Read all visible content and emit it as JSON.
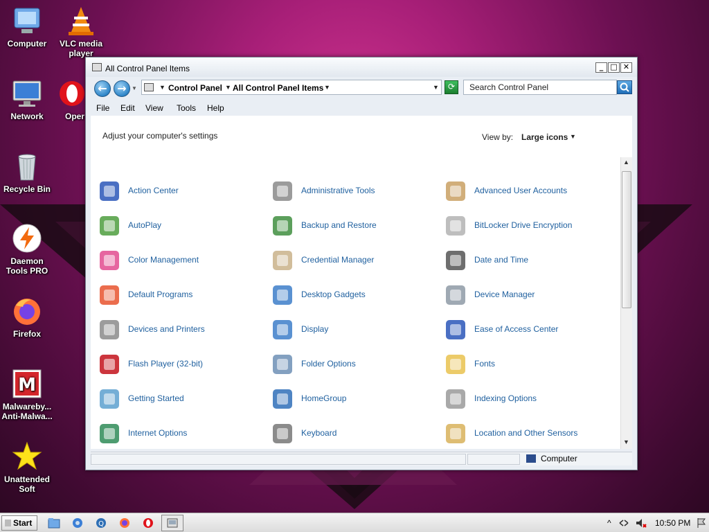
{
  "desktop": {
    "icons": [
      {
        "name": "computer",
        "label": "Computer"
      },
      {
        "name": "vlc",
        "label": "VLC media player"
      },
      {
        "name": "network",
        "label": "Network"
      },
      {
        "name": "opera",
        "label": "Opera Browser"
      },
      {
        "name": "recycle",
        "label": "Recycle Bin"
      },
      {
        "name": "daemon",
        "label": "Daemon Tools PRO"
      },
      {
        "name": "firefox",
        "label": "Firefox"
      },
      {
        "name": "malwarebytes",
        "label": "Malwareby... Anti-Malwa..."
      },
      {
        "name": "unattended",
        "label": "Unattended Soft"
      }
    ]
  },
  "window": {
    "title": "All Control Panel Items",
    "controls": {
      "minimize": "_",
      "maximize": "□",
      "close": "✕"
    },
    "address": {
      "crumbs": [
        "Control Panel",
        "All Control Panel Items"
      ]
    },
    "search": {
      "placeholder": "Search Control Panel"
    },
    "menu": [
      "File",
      "Edit",
      "View",
      "Tools",
      "Help"
    ],
    "heading": "Adjust your computer's settings",
    "view_by_label": "View by:",
    "view_by_value": "Large icons",
    "items": [
      {
        "label": "Action Center",
        "icon": "flag-icon"
      },
      {
        "label": "Administrative Tools",
        "icon": "tools-icon"
      },
      {
        "label": "Advanced User Accounts",
        "icon": "users-icon"
      },
      {
        "label": "AutoPlay",
        "icon": "autoplay-icon"
      },
      {
        "label": "Backup and Restore",
        "icon": "backup-icon"
      },
      {
        "label": "BitLocker Drive Encryption",
        "icon": "bitlocker-icon"
      },
      {
        "label": "Color Management",
        "icon": "color-icon"
      },
      {
        "label": "Credential Manager",
        "icon": "credential-icon"
      },
      {
        "label": "Date and Time",
        "icon": "clock-icon"
      },
      {
        "label": "Default Programs",
        "icon": "default-programs-icon"
      },
      {
        "label": "Desktop Gadgets",
        "icon": "gadgets-icon"
      },
      {
        "label": "Device Manager",
        "icon": "device-manager-icon"
      },
      {
        "label": "Devices and Printers",
        "icon": "printer-icon"
      },
      {
        "label": "Display",
        "icon": "display-icon"
      },
      {
        "label": "Ease of Access Center",
        "icon": "ease-access-icon"
      },
      {
        "label": "Flash Player (32-bit)",
        "icon": "flash-icon"
      },
      {
        "label": "Folder Options",
        "icon": "folder-icon"
      },
      {
        "label": "Fonts",
        "icon": "fonts-icon"
      },
      {
        "label": "Getting Started",
        "icon": "getting-started-icon"
      },
      {
        "label": "HomeGroup",
        "icon": "homegroup-icon"
      },
      {
        "label": "Indexing Options",
        "icon": "indexing-icon"
      },
      {
        "label": "Internet Options",
        "icon": "internet-icon"
      },
      {
        "label": "Keyboard",
        "icon": "keyboard-icon"
      },
      {
        "label": "Location and Other Sensors",
        "icon": "location-icon"
      }
    ],
    "status": {
      "text": "Computer"
    }
  },
  "taskbar": {
    "start_label": "Start",
    "clock": "10:50 PM",
    "tray_arrow": "^"
  }
}
